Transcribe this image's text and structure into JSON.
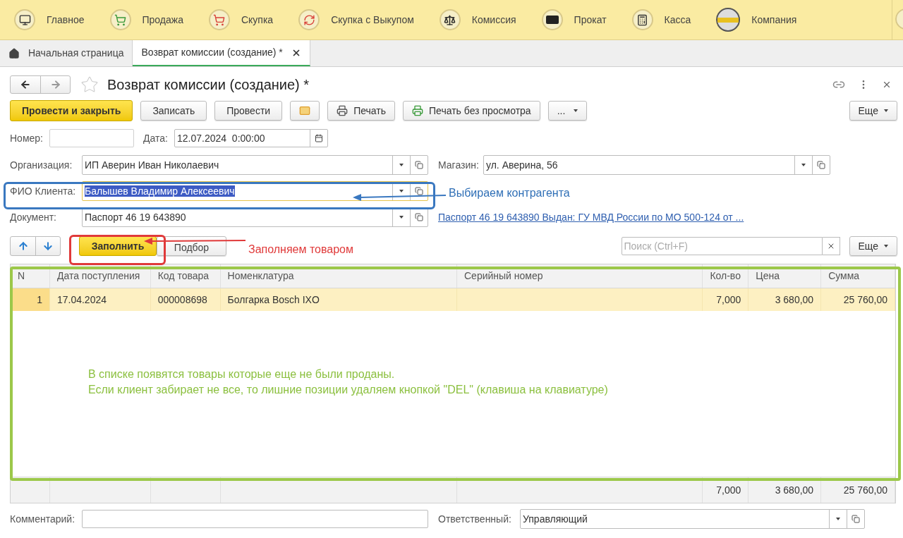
{
  "nav": [
    {
      "label": "Главное"
    },
    {
      "label": "Продажа"
    },
    {
      "label": "Скупка"
    },
    {
      "label": "Скупка с Выкупом"
    },
    {
      "label": "Комиссия"
    },
    {
      "label": "Прокат"
    },
    {
      "label": "Касса"
    },
    {
      "label": "Компания"
    }
  ],
  "tabs": [
    {
      "label": "Начальная страница",
      "kind": "home",
      "selected": false
    },
    {
      "label": "Возврат комиссии (создание) *",
      "kind": "doc",
      "selected": true
    }
  ],
  "form": {
    "title": "Возврат комиссии (создание) *",
    "toolbar": [
      {
        "kind": "primary",
        "label": "Провести и закрыть"
      },
      {
        "kind": "plain",
        "label": "Записать"
      },
      {
        "kind": "plain",
        "label": "Провести"
      },
      {
        "kind": "mail"
      },
      {
        "kind": "print",
        "label": "Печать"
      },
      {
        "kind": "print-direct",
        "label": "Печать без просмотра"
      },
      {
        "kind": "menu",
        "label": "..."
      }
    ],
    "more": "Еще",
    "number": {
      "label": "Номер:"
    },
    "date": {
      "label": "Дата:",
      "value": "12.07.2024  0:00:00"
    },
    "organization": {
      "label": "Организация:",
      "value": "ИП Аверин Иван Николаевич"
    },
    "shop": {
      "label": "Магазин:",
      "value": "ул. Аверина, 56"
    },
    "client": {
      "label": "ФИО Клиента:",
      "value": "Балышев Владимир Алексеевич",
      "focused": true
    },
    "document": {
      "label": "Документ:",
      "value": "Паспорт 46 19 643890",
      "link": "Паспорт 46 19 643890 Выдан: ГУ МВД России по МО 500-124 от ..."
    },
    "table_toolbar": {
      "fill": "Заполнить",
      "pick": "Подбор",
      "search_placeholder": "Поиск (Ctrl+F)",
      "more": "Еще"
    },
    "table": {
      "columns": [
        "N",
        "Дата поступления",
        "Код товара",
        "Номенклатура",
        "Серийный номер",
        "Кол-во",
        "Цена",
        "Сумма"
      ],
      "rows": [
        {
          "cells": [
            "1",
            "17.04.2024",
            "000008698",
            "Болгарка Bosch IXO",
            "",
            "7,000",
            "3 680,00",
            "25 760,00"
          ],
          "selected": true
        }
      ],
      "totals": {
        "quantity": "7,000",
        "price": "3 680,00",
        "sum": "25 760,00"
      }
    },
    "comment": {
      "label": "Комментарий:"
    },
    "responsible": {
      "label": "Ответственный:",
      "value": "Управляющий"
    }
  },
  "annotations": {
    "client": "Выбираем контрагента",
    "fill": "Заполняем товаром",
    "table_note": [
      "В списке появятся товары которые еще не были проданы.",
      "Если клиент забирает не все, то лишние позиции удаляем кнопкой \"DEL\" (клавиша на клавиатуре)"
    ]
  }
}
